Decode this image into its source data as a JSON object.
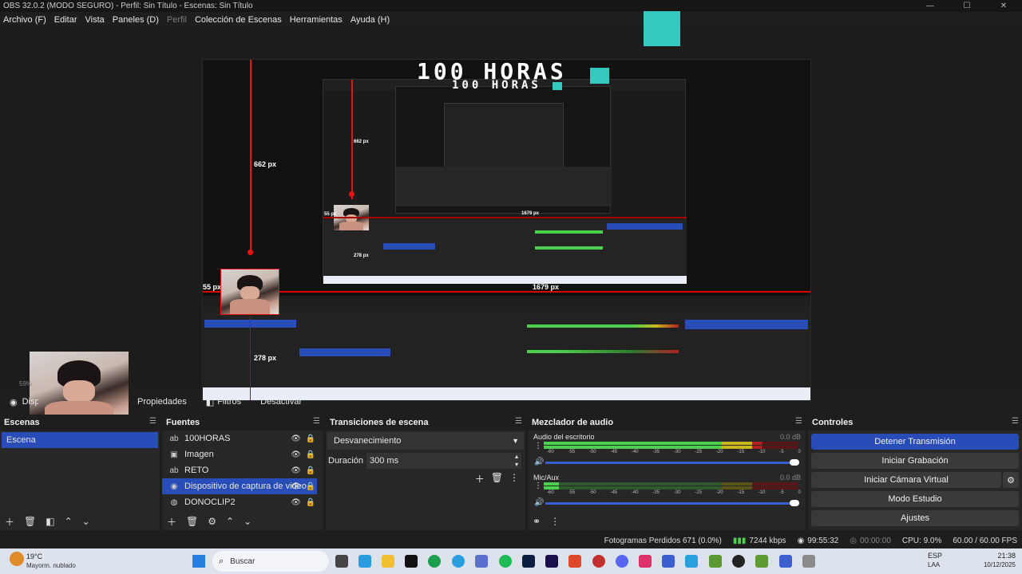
{
  "window": {
    "title": "OBS 32.0.2 (MODO SEGURO) - Perfil: Sin Título - Escenas: Sin Título"
  },
  "menu": [
    "Archivo (F)",
    "Editar",
    "Vista",
    "Paneles (D)",
    "Perfil",
    "Colección de Escenas",
    "Herramientas",
    "Ayuda (H)"
  ],
  "preview": {
    "labels": {
      "height_outer": "662 px",
      "width_outer": "1679 px",
      "left_outer": "55 px",
      "bottom_outer": "278 px",
      "height_inner": "662 px",
      "width_inner": "1679 px",
      "left_inner": "55 px",
      "bottom_inner": "278 px"
    },
    "title_text": "100 HORAS",
    "zoom": "59%"
  },
  "toolbar": {
    "source_name": "Dispositivo de captura de video",
    "props": "Propiedades",
    "filters": "Filtros",
    "deactivate": "Desactivar"
  },
  "scenes": {
    "title": "Escenas",
    "items": [
      "Escena"
    ]
  },
  "sources": {
    "title": "Fuentes",
    "items": [
      "100HORAS",
      "Imagen",
      "RETO",
      "Dispositivo de captura de video",
      "DONOCLIP2"
    ]
  },
  "transitions": {
    "title": "Transiciones de escena",
    "type": "Desvanecimiento",
    "duration_label": "Duración",
    "duration": "300 ms"
  },
  "mixer": {
    "title": "Mezclador de audio",
    "channels": [
      {
        "name": "Audio del escritorio",
        "db": "0.0 dB",
        "level": 0.86
      },
      {
        "name": "Mic/Aux",
        "db": "0.0 dB",
        "level": 0.06
      }
    ],
    "scale": [
      "-60",
      "-55",
      "-50",
      "-45",
      "-40",
      "-35",
      "-30",
      "-25",
      "-20",
      "-15",
      "-10",
      "-5",
      "0"
    ]
  },
  "controls": {
    "title": "Controles",
    "buttons": [
      "Detener Transmisión",
      "Iniciar Grabación",
      "Iniciar Cámara Virtual",
      "Modo Estudio",
      "Ajustes"
    ]
  },
  "status": {
    "dropped": "Fotogramas Perdidos 671 (0.0%)",
    "kbps": "7244 kbps",
    "stream_time": "99:55:32",
    "rec_time": "00:00:00",
    "cpu": "CPU: 9.0%",
    "fps": "60.00 / 60.00 FPS"
  },
  "taskbar": {
    "weather_temp": "19°C",
    "weather_desc": "Mayorm. nublado",
    "search": "Buscar",
    "lang": "ESP",
    "lang2": "LAA",
    "time": "21:38",
    "date": "10/12/2025"
  },
  "colors": {
    "accent": "#284cb8",
    "meter_green": "#4cd14c",
    "meter_yellow": "#c9b820",
    "meter_red": "#b32020"
  }
}
